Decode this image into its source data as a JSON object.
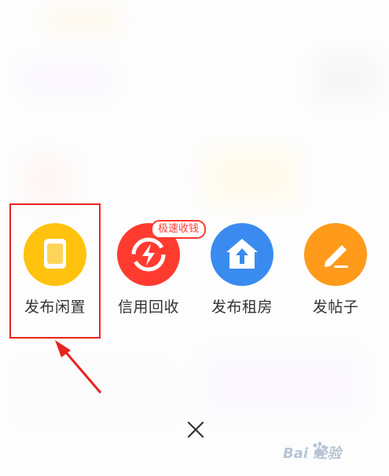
{
  "menu": {
    "items": [
      {
        "label": "发布闲置",
        "icon": "idle-item-icon"
      },
      {
        "label": "信用回收",
        "icon": "credit-recycle-icon"
      },
      {
        "label": "发布租房",
        "icon": "rent-house-icon"
      },
      {
        "label": "发帖子",
        "icon": "post-edit-icon"
      }
    ],
    "badge": "极速收钱"
  },
  "close": {
    "icon": "close-icon"
  },
  "watermark": {
    "text": "Bai 经验",
    "icon": "paw-icon"
  },
  "colors": {
    "idle": "#ffc20e",
    "credit": "#ff3b30",
    "rent": "#3a8bf0",
    "post": "#ff9a1a",
    "highlight": "#e8231d"
  }
}
